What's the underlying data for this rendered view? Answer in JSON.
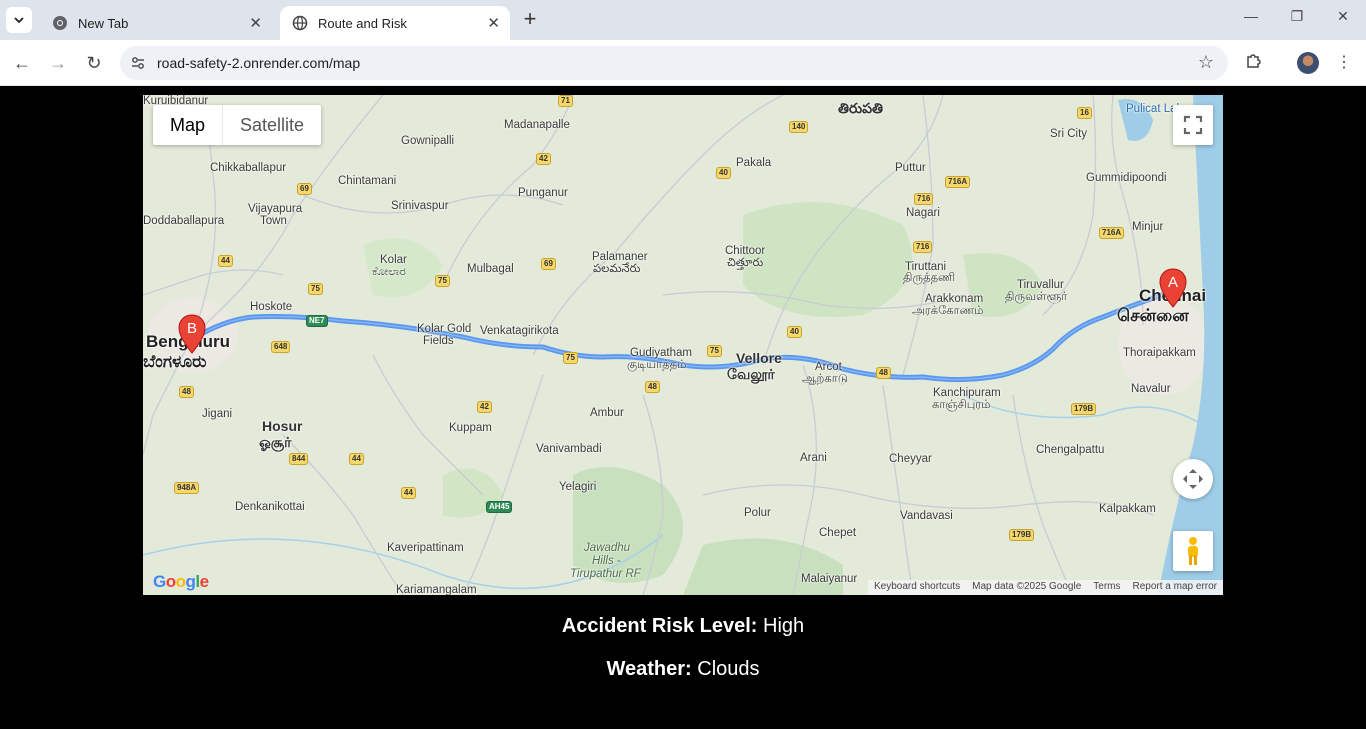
{
  "browser": {
    "tabs": [
      {
        "title": "New Tab"
      },
      {
        "title": "Route and Risk"
      }
    ],
    "url": "road-safety-2.onrender.com/map"
  },
  "map": {
    "type_buttons": {
      "map": "Map",
      "satellite": "Satellite"
    },
    "attribution": {
      "keyboard": "Keyboard shortcuts",
      "data": "Map data ©2025 Google",
      "terms": "Terms",
      "report": "Report a map error"
    },
    "markers": {
      "origin": "A",
      "destination": "B"
    },
    "route_color": "#4285f4",
    "places": {
      "chennai": "Chennai",
      "chennai_ta": "சென்னை",
      "bengaluru": "Bengaluru",
      "bengaluru_kn": "ಬೆಂಗಳೂರು",
      "vellore": "Vellore",
      "vellore_ta": "வேலூர்",
      "hosur": "Hosur",
      "hosur_ta": "ஓசூர்",
      "tirupati_te": "తిరుపతి",
      "kolar": "Kolar",
      "kolar_kn": "ಕೋಲಾರ",
      "kolar_gold": "Kolar Gold",
      "fields": "Fields",
      "venkatagirikota": "Venkatagirikota",
      "gudiyatham": "Gudiyatham",
      "gudiyatham_ta": "குடியாத்தம்",
      "arcot": "Arcot",
      "arcot_ta": "ஆற்காடு",
      "kanchipuram": "Kanchipuram",
      "kanchipuram_ta": "காஞ்சிபுரம்",
      "hoskote": "Hoskote",
      "chittoor": "Chittoor",
      "chittoor_te": "చిత్తూరు",
      "palamaner": "Palamaner",
      "palamaner_te": "పలమనేరు",
      "mulbagal": "Mulbagal",
      "madanapalle": "Madanapalle",
      "punganur": "Punganur",
      "chintamani": "Chintamani",
      "srinivaspur": "Srinivaspur",
      "chikkaballapur": "Chikkaballapur",
      "vijayapura": "Vijayapura",
      "town": "Town",
      "doddaballapura": "Doddaballapura",
      "gownipalli": "Gownipalli",
      "pakala": "Pakala",
      "puttur": "Puttur",
      "nagari": "Nagari",
      "tiruttani": "Tiruttani",
      "tiruttani_ta": "திருத்தணி",
      "arakkonam": "Arakkonam",
      "arakkonam_ta": "அரக்கோணம்",
      "tiruvallur": "Tiruvallur",
      "tiruvallur_ta": "திருவள்ளூர்",
      "sri_city": "Sri City",
      "gummidipoondi": "Gummidipoondi",
      "minjur": "Minjur",
      "pulicat": "Pulicat Lake",
      "thoraipakkam": "Thoraipakkam",
      "navalur": "Navalur",
      "chengalpattu": "Chengalpattu",
      "kalpakkam": "Kalpakkam",
      "vandavasi": "Vandavasi",
      "cheyyar": "Cheyyar",
      "arani": "Arani",
      "polur": "Polur",
      "chepet": "Chepet",
      "malaiyanur": "Malaiyanur",
      "jawadhu": "Jawadhu",
      "hills": "Hills -",
      "tirupathur_rf": "Tirupathur RF",
      "yelagiri": "Yelagiri",
      "vanivambadi": "Vanivambadi",
      "ambur": "Ambur",
      "kuppam": "Kuppam",
      "jigani": "Jigani",
      "denkanikottai": "Denkanikottai",
      "kaveripattinam": "Kaveripattinam",
      "kariamangalam": "Kariamangalam",
      "kuruibidanur": "Kuruibidanur"
    },
    "highways": [
      "71",
      "140",
      "16",
      "42",
      "40",
      "716A",
      "69",
      "75",
      "44",
      "648",
      "NE7",
      "48",
      "179B",
      "844",
      "948A",
      "AH45",
      "716"
    ]
  },
  "risk": {
    "label": "Accident Risk Level:",
    "value": "High"
  },
  "weather": {
    "label": "Weather:",
    "value": "Clouds"
  }
}
